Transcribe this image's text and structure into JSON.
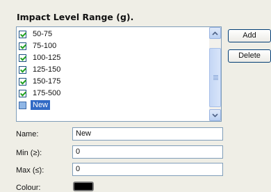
{
  "panel": {
    "title": "Impact Level Range (g)."
  },
  "list": {
    "items": [
      {
        "label": "50-75",
        "checked": true,
        "selected": false
      },
      {
        "label": "75-100",
        "checked": true,
        "selected": false
      },
      {
        "label": "100-125",
        "checked": true,
        "selected": false
      },
      {
        "label": "125-150",
        "checked": true,
        "selected": false
      },
      {
        "label": "150-175",
        "checked": true,
        "selected": false
      },
      {
        "label": "175-500",
        "checked": true,
        "selected": false
      },
      {
        "label": "New",
        "checked": false,
        "selected": true
      }
    ]
  },
  "buttons": {
    "add": "Add",
    "delete": "Delete"
  },
  "form": {
    "name_label": "Name:",
    "name_value": "New",
    "min_label": "Min (≥):",
    "min_value": "0",
    "max_label": "Max (≤):",
    "max_value": "0",
    "colour_label": "Colour:",
    "colour_value": "#000000"
  },
  "icons": {
    "scroll_up": "chevron-up-icon",
    "scroll_down": "chevron-down-icon"
  }
}
